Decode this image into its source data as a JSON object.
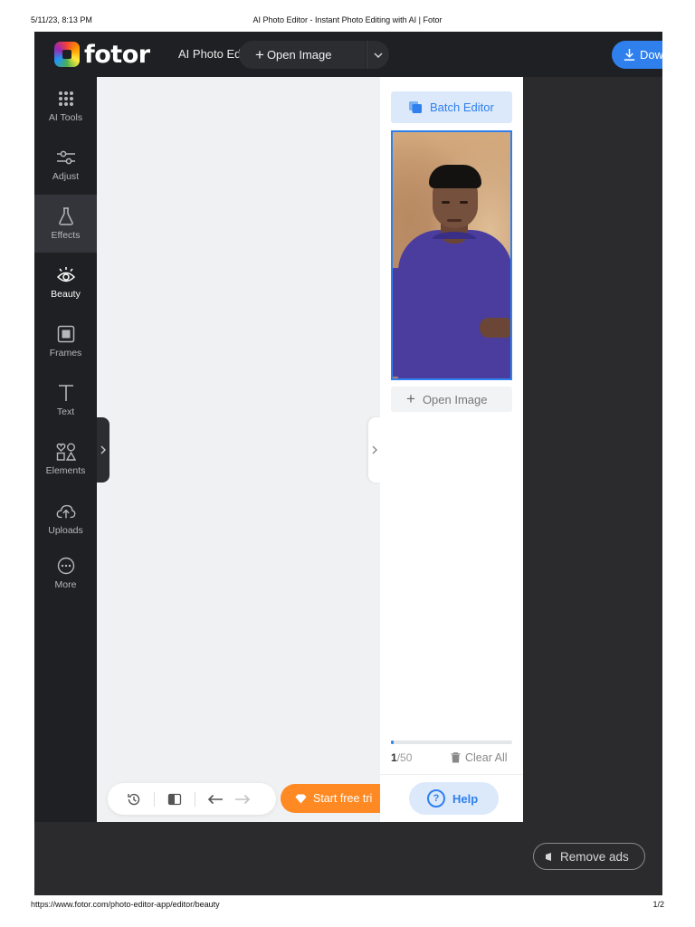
{
  "print": {
    "datetime": "5/11/23, 8:13 PM",
    "page_title": "AI Photo Editor - Instant Photo Editing with AI | Fotor",
    "url": "https://www.fotor.com/photo-editor-app/editor/beauty",
    "page_number": "1/2"
  },
  "header": {
    "logo": "fotor",
    "app_title": "AI Photo Editor",
    "open_image": "Open Image",
    "download": "Dow"
  },
  "sidebar": {
    "items": [
      {
        "label": "AI Tools",
        "icon": "grid-dots-icon"
      },
      {
        "label": "Adjust",
        "icon": "sliders-icon"
      },
      {
        "label": "Effects",
        "icon": "flask-icon"
      },
      {
        "label": "Beauty",
        "icon": "eye-icon"
      },
      {
        "label": "Frames",
        "icon": "frame-icon"
      },
      {
        "label": "Text",
        "icon": "text-icon"
      },
      {
        "label": "Elements",
        "icon": "shapes-icon"
      },
      {
        "label": "Uploads",
        "icon": "cloud-upload-icon"
      },
      {
        "label": "More",
        "icon": "more-icon"
      }
    ],
    "active": "Beauty",
    "hover": "Effects"
  },
  "toolbar": {
    "trial": "Start free tri"
  },
  "panel": {
    "batch_editor": "Batch Editor",
    "open_image": "Open Image",
    "count_current": "1",
    "count_total": "/50",
    "progress": 0.02,
    "clear_all": "Clear All",
    "help": "Help"
  },
  "ads": {
    "remove_ads": "Remove ads"
  },
  "colors": {
    "accent": "#2f80ed",
    "trial": "#ff8a24",
    "sidebar_bg": "#1f2023",
    "workspace_bg": "#2b2b2d"
  }
}
